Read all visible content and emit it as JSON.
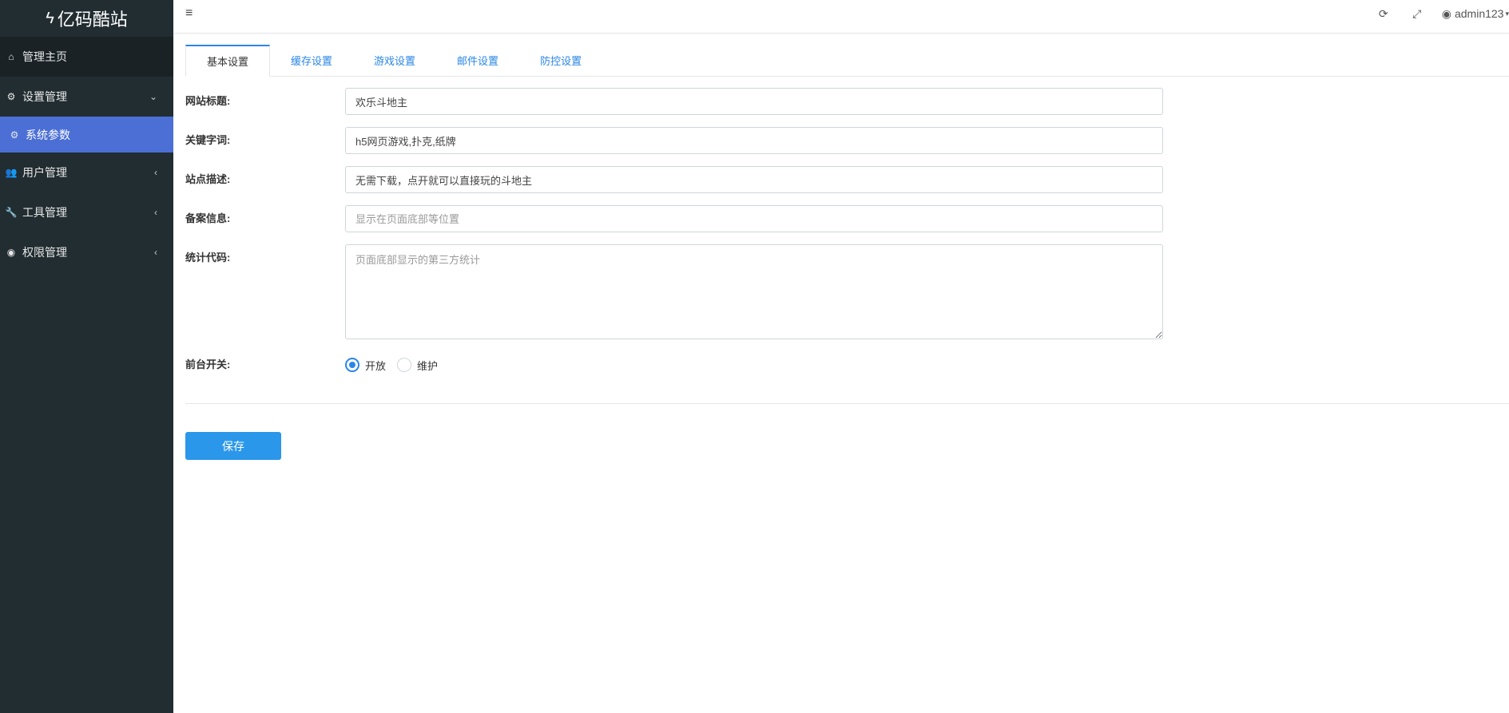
{
  "brand": {
    "title": "亿码酷站",
    "bolt": "ϟ"
  },
  "sidebar": {
    "items": [
      {
        "label": "管理主页",
        "icon": "⌂"
      },
      {
        "label": "设置管理",
        "icon": "⚙",
        "arrow": "⌄"
      },
      {
        "label": "系统参数",
        "icon": "⚙"
      },
      {
        "label": "用户管理",
        "icon": "👥",
        "arrow": "‹"
      },
      {
        "label": "工具管理",
        "icon": "🔧",
        "arrow": "‹"
      },
      {
        "label": "权限管理",
        "icon": "◉",
        "arrow": "‹"
      }
    ]
  },
  "topbar": {
    "menu_icon": "≡",
    "refresh_icon": "⟳",
    "fullscreen_icon": "⤢",
    "user_icon": "◉",
    "username": "admin123",
    "caret": "▾"
  },
  "tabs": [
    "基本设置",
    "缓存设置",
    "游戏设置",
    "邮件设置",
    "防控设置"
  ],
  "form": {
    "site_title": {
      "label": "网站标题:",
      "value": "欢乐斗地主",
      "placeholder": ""
    },
    "keywords": {
      "label": "关键字词:",
      "value": "h5网页游戏,扑克,纸牌",
      "placeholder": ""
    },
    "description": {
      "label": "站点描述:",
      "value": "无需下载，点开就可以直接玩的斗地主",
      "placeholder": ""
    },
    "icp": {
      "label": "备案信息:",
      "value": "",
      "placeholder": "显示在页面底部等位置"
    },
    "stats_code": {
      "label": "统计代码:",
      "value": "",
      "placeholder": "页面底部显示的第三方统计"
    },
    "frontend_switch": {
      "label": "前台开关:",
      "options": [
        "开放",
        "维护"
      ],
      "selected": "开放"
    }
  },
  "save_label": "保存",
  "colors": {
    "sidebar_bg": "#222d32",
    "active_item": "#4b6fd5",
    "accent": "#2a86e6",
    "button": "#2a97ea"
  }
}
